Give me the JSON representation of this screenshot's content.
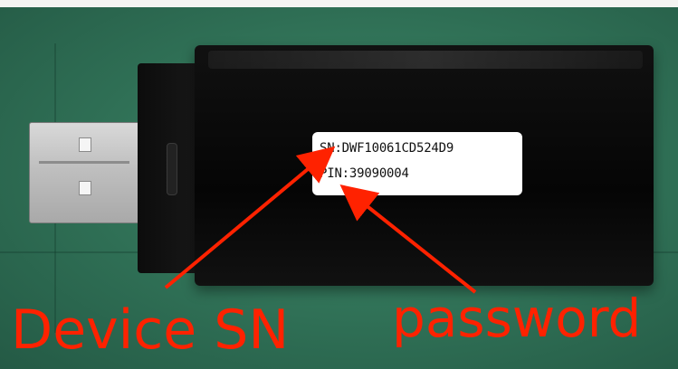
{
  "photo": {
    "device": "usb-dongle",
    "label": {
      "sn_line": "SN:DWF10061CD524D9",
      "pin_line": "PIN:39090004"
    }
  },
  "annotations": {
    "device_sn": "Device SN",
    "password": "password",
    "color": "#ff2200"
  },
  "colors": {
    "background": "#2f6f55",
    "device_body": "#0b0b0b",
    "usb_metal": "#c4c4c4",
    "label_bg": "#ffffff"
  }
}
